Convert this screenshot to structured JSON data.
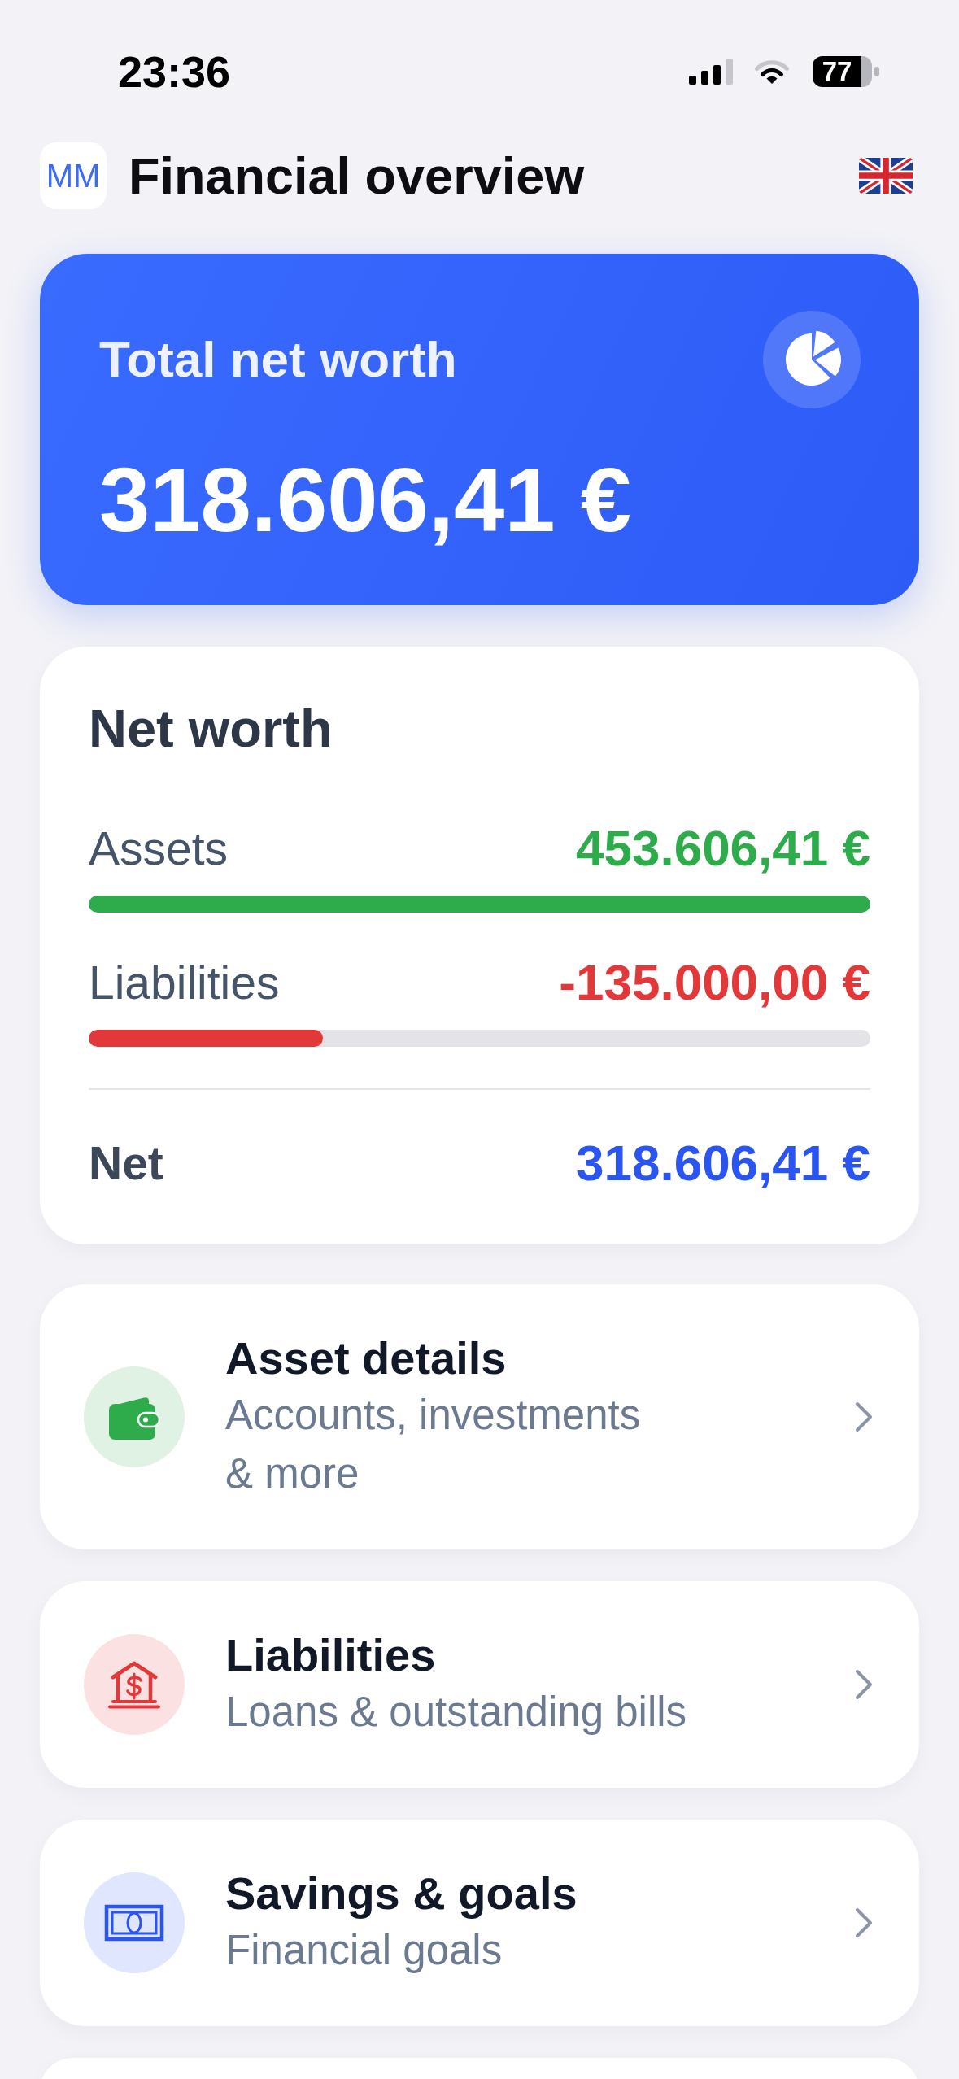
{
  "status_bar": {
    "time": "23:36",
    "battery": "77"
  },
  "header": {
    "logo": "MM",
    "title": "Financial overview"
  },
  "total_card": {
    "title": "Total net worth",
    "amount": "318.606,41 €"
  },
  "net_worth": {
    "title": "Net worth",
    "rows": [
      {
        "kind": "bar",
        "label": "Assets",
        "value": "453.606,41 €",
        "color": "#2eab4a",
        "level": 1
      },
      {
        "kind": "bar",
        "label": "Liabilities",
        "value": "-135.000,00 €",
        "color": "#e3383a",
        "level": 0.3
      },
      {
        "kind": "total",
        "label": "Net",
        "value": "318.606,41 €",
        "color": "#2b55f0"
      }
    ]
  },
  "nav_cards": [
    {
      "kind": "wallet",
      "color": "#2eab4a",
      "title": "Asset details",
      "subtitle": "Accounts, investments\n& more"
    },
    {
      "kind": "bank",
      "color": "#e3383a",
      "title": "Liabilities",
      "subtitle": "Loans & outstanding bills"
    },
    {
      "kind": "banknote",
      "color": "#2b55f0",
      "title": "Savings & goals",
      "subtitle": "Financial goals"
    }
  ]
}
